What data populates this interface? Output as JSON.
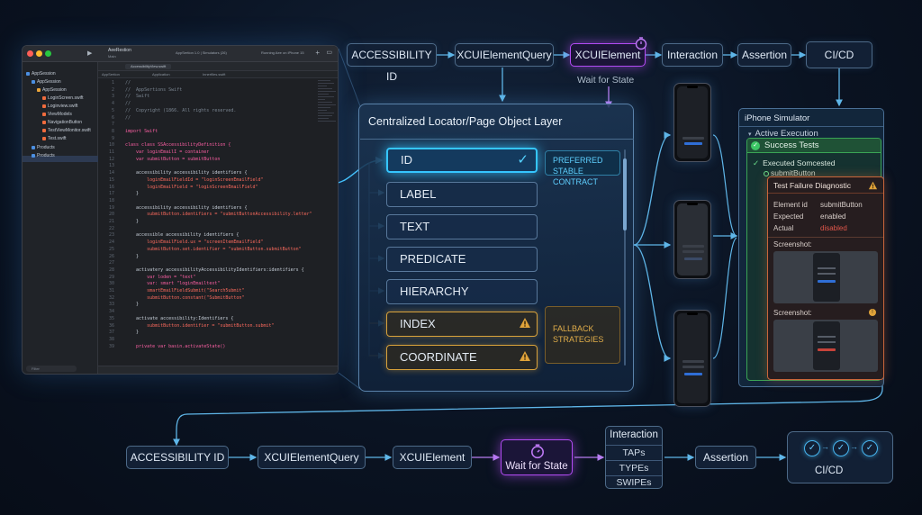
{
  "top_pipeline": {
    "accessibility_id": "ACCESSIBILITY ID",
    "query": "XCUIElementQuery",
    "element": "XCUIElement",
    "interaction": "Interaction",
    "assertion": "Assertion",
    "cicd": "CI/CD",
    "wait_label": "Wait for State"
  },
  "xcode": {
    "title": "AeeRestion",
    "subtitle": "Main",
    "tab": "AppSertion 1.0 | Simulators (26)",
    "status": "Running Aee on iPhone 15",
    "open_tab": "AccessibilityView.swift",
    "crumbs": [
      "AppSertion",
      "Application",
      "Innerfiles.swift"
    ],
    "filter": "Filter",
    "navigator": [
      "AppSession",
      "AppSession",
      "AppSession",
      "LoginScreen.swift",
      "Loginview.swift",
      "ViewModels",
      "NavigationButton",
      "TestViewMonitor.swift",
      "Test.swift",
      "Products",
      "Products"
    ],
    "code_lines": [
      {
        "n": "1",
        "t": "//"
      },
      {
        "n": "2",
        "t": "//  AppSertions Swift"
      },
      {
        "n": "3",
        "t": "//  Swift"
      },
      {
        "n": "4",
        "t": "//"
      },
      {
        "n": "5",
        "t": "//  Copyright (1866. All rights reserved."
      },
      {
        "n": "6",
        "t": "//"
      },
      {
        "n": "7",
        "t": ""
      },
      {
        "n": "8",
        "t": "import Swift"
      },
      {
        "n": "9",
        "t": ""
      },
      {
        "n": "10",
        "t": "class class SSAccessibilityDefinition {"
      },
      {
        "n": "11",
        "t": "    var loginEmailI = container"
      },
      {
        "n": "12",
        "t": "    var submitButton = submitButton"
      },
      {
        "n": "13",
        "t": ""
      },
      {
        "n": "14",
        "t": "    accessibility accessibility identifiers {"
      },
      {
        "n": "15",
        "t": "        loginEmailFieldId = \"loginScreenEmailField\""
      },
      {
        "n": "16",
        "t": "        loginEmailField = \"loginScreenEmailField\""
      },
      {
        "n": "17",
        "t": "    }"
      },
      {
        "n": "18",
        "t": ""
      },
      {
        "n": "19",
        "t": "    accessibility accessibility identifiers {"
      },
      {
        "n": "20",
        "t": "        submitButton.identifiers = \"submitButtonAccessibility.letter\""
      },
      {
        "n": "21",
        "t": "    }"
      },
      {
        "n": "22",
        "t": ""
      },
      {
        "n": "23",
        "t": "    accessible accessibility identifiers {"
      },
      {
        "n": "24",
        "t": "        loginEmailField.ux = \"screenItemEmailField\""
      },
      {
        "n": "25",
        "t": "        submitButton.set.identifier = \"submitButton.submitButton\""
      },
      {
        "n": "26",
        "t": "    }"
      },
      {
        "n": "27",
        "t": ""
      },
      {
        "n": "28",
        "t": "    activatery accessibilityAccessibilityIdentifiers:identifiers {"
      },
      {
        "n": "29",
        "t": "        var loden = \"text\""
      },
      {
        "n": "30",
        "t": "        var: smart \"loginEmailtext\""
      },
      {
        "n": "31",
        "t": "        smartEmailFieldSubmit(\"Search5ubmit\""
      },
      {
        "n": "32",
        "t": "        submitButton.constant(\"SubmitButton\""
      },
      {
        "n": "33",
        "t": "    }"
      },
      {
        "n": "34",
        "t": ""
      },
      {
        "n": "35",
        "t": "    activate accessibility:Identifiers {"
      },
      {
        "n": "36",
        "t": "        submitButton.identifier = \"submitButton.submit\""
      },
      {
        "n": "37",
        "t": "    }"
      },
      {
        "n": "38",
        "t": ""
      },
      {
        "n": "39",
        "t": "    private var basin.activateState()"
      }
    ]
  },
  "locator_layer": {
    "title": "Centralized Locator/Page Object Layer",
    "items": [
      {
        "label": "ID",
        "kind": "primary"
      },
      {
        "label": "LABEL",
        "kind": "normal"
      },
      {
        "label": "TEXT",
        "kind": "normal"
      },
      {
        "label": "PREDICATE",
        "kind": "normal"
      },
      {
        "label": "HIERARCHY",
        "kind": "normal"
      },
      {
        "label": "INDEX",
        "kind": "warning"
      },
      {
        "label": "COORDINATE",
        "kind": "warning"
      }
    ],
    "preferred_tag": "PREFERRED STABLE CONTRACT",
    "fallback_tag": "FALLBACK STRATEGIES",
    "check_icon": "checkmark-icon",
    "warning_icon": "warning-triangle-icon"
  },
  "simulator": {
    "title": "iPhone Simulator",
    "active": "Active Execution",
    "success_title": "Success Tests",
    "executed": "Executed Somcested",
    "submit": "submitButton",
    "failure": {
      "title": "Test Failure Diagnostic",
      "element_id_label": "Element id",
      "element_id_value": "submitButton",
      "expected_label": "Expected",
      "expected_value": "enabled",
      "actual_label": "Actual",
      "actual_value": "disabled",
      "screenshot_label": "Screenshot:",
      "screenshot_label_2": "Screenshot:"
    }
  },
  "bottom_pipeline": {
    "accessibility_id": "ACCESSIBILITY ID",
    "query": "XCUIElementQuery",
    "element": "XCUIElement",
    "wait": "Wait for State",
    "interaction": "Interaction",
    "taps": "TAPs",
    "types": "TYPEs",
    "swipes": "SWIPEs",
    "assertion": "Assertion",
    "cicd": "CI/CD"
  },
  "colors": {
    "primary_glow": "#35c6ff",
    "warning": "#d9a23b",
    "wait_purple": "#b24bf3",
    "success_green": "#3aa455",
    "failure_orange": "#c9663a",
    "disabled_red": "#e0564a"
  }
}
